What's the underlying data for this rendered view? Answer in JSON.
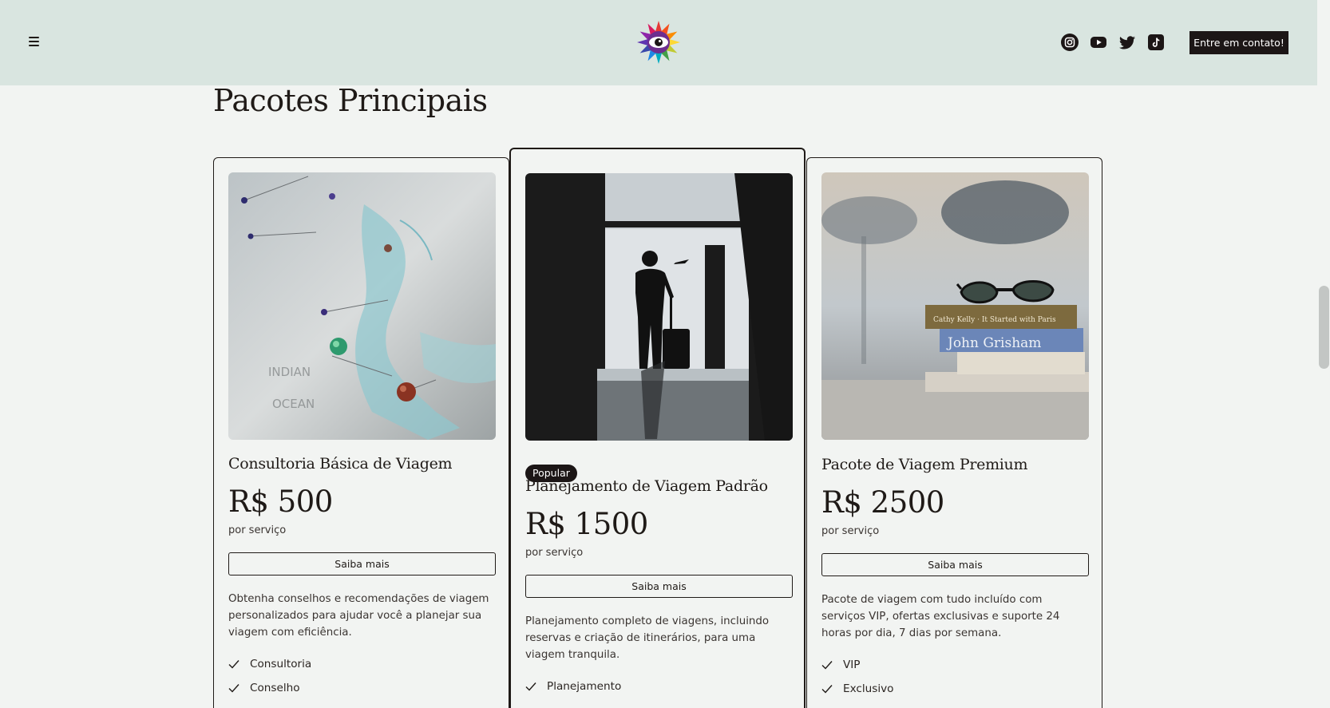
{
  "header": {
    "menu_icon": "hamburger-menu-icon",
    "logo_icon": "rainbow-eye-logo",
    "social_icons": [
      "instagram-icon",
      "youtube-icon",
      "twitter-icon",
      "tiktok-icon"
    ],
    "cta_label": "Entre em contato!"
  },
  "section": {
    "title": "Pacotes Principais"
  },
  "cards": [
    {
      "image": "world-map-with-pins",
      "title": "Consultoria Básica de Viagem",
      "price": "R$ 500",
      "unit": "por serviço",
      "button_label": "Saiba mais",
      "description": "Obtenha conselhos e recomendações de viagem personalizados para ajudar você a planejar sua viagem com eficiência.",
      "features": [
        "Consultoria",
        "Conselho"
      ]
    },
    {
      "image": "traveler-silhouette-with-suitcase",
      "badge": "Popular",
      "title": "Planejamento de Viagem Padrão",
      "price": "R$ 1500",
      "unit": "por serviço",
      "button_label": "Saiba mais",
      "description": "Planejamento completo de viagens, incluindo reservas e criação de itinerários, para uma viagem tranquila.",
      "features": [
        "Planejamento"
      ]
    },
    {
      "image": "sunglasses-on-books-beach",
      "title": "Pacote de Viagem Premium",
      "price": "R$ 2500",
      "unit": "por serviço",
      "button_label": "Saiba mais",
      "description": "Pacote de viagem com tudo incluído com serviços VIP, ofertas exclusivas e suporte 24 horas por dia, 7 dias por semana.",
      "features": [
        "VIP",
        "Exclusivo"
      ]
    }
  ],
  "colors": {
    "header_bg": "#d9e5e0",
    "page_bg": "#f2f4f2",
    "dark": "#1c1616"
  }
}
